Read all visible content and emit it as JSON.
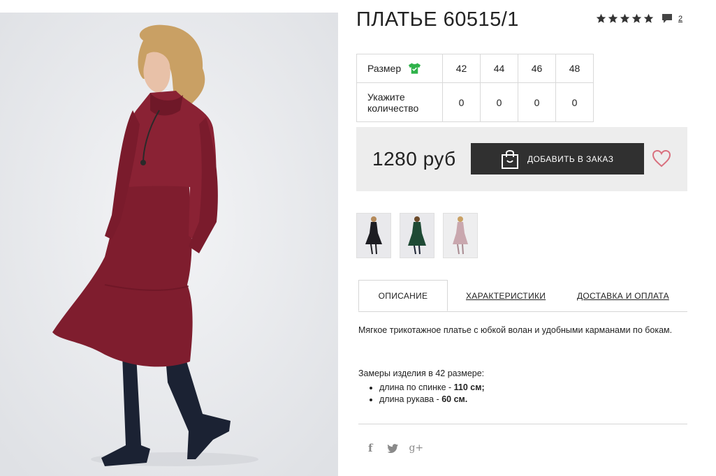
{
  "product": {
    "title": "ПЛАТЬЕ 60515/1",
    "rating_icons": "star-icon",
    "comment_count": "2"
  },
  "size_table": {
    "size_label": "Размер",
    "quantity_label_line1": "Укажите",
    "quantity_label_line2": "количество",
    "sizes": [
      "42",
      "44",
      "46",
      "48"
    ],
    "quantities": [
      "0",
      "0",
      "0",
      "0"
    ]
  },
  "purchase": {
    "price": "1280 руб",
    "order_button": "ДОБАВИТЬ В ЗАКАЗ"
  },
  "tabs": {
    "description": "ОПИСАНИЕ",
    "characteristics": "ХАРАКТЕРИСТИКИ",
    "delivery": "ДОСТАВКА И ОПЛАТА"
  },
  "description": {
    "text": "Мягкое трикотажное платье с юбкой волан и удобными карманами по бокам.",
    "measurements_title": "Замеры изделия в 42 размере:",
    "measurements": [
      {
        "label": "длина по спинке - ",
        "value": "110 см;"
      },
      {
        "label": "длина рукава - ",
        "value": "60 см."
      }
    ]
  },
  "social": {
    "facebook": "f",
    "twitter": "twitter-icon",
    "google_plus": "g+"
  },
  "colors": {
    "dress": "#7f1d2e",
    "button_bg": "#303030",
    "panel_bg": "#ededed",
    "heart": "#d9707e",
    "tshirt_icon": "#2fb24a"
  }
}
